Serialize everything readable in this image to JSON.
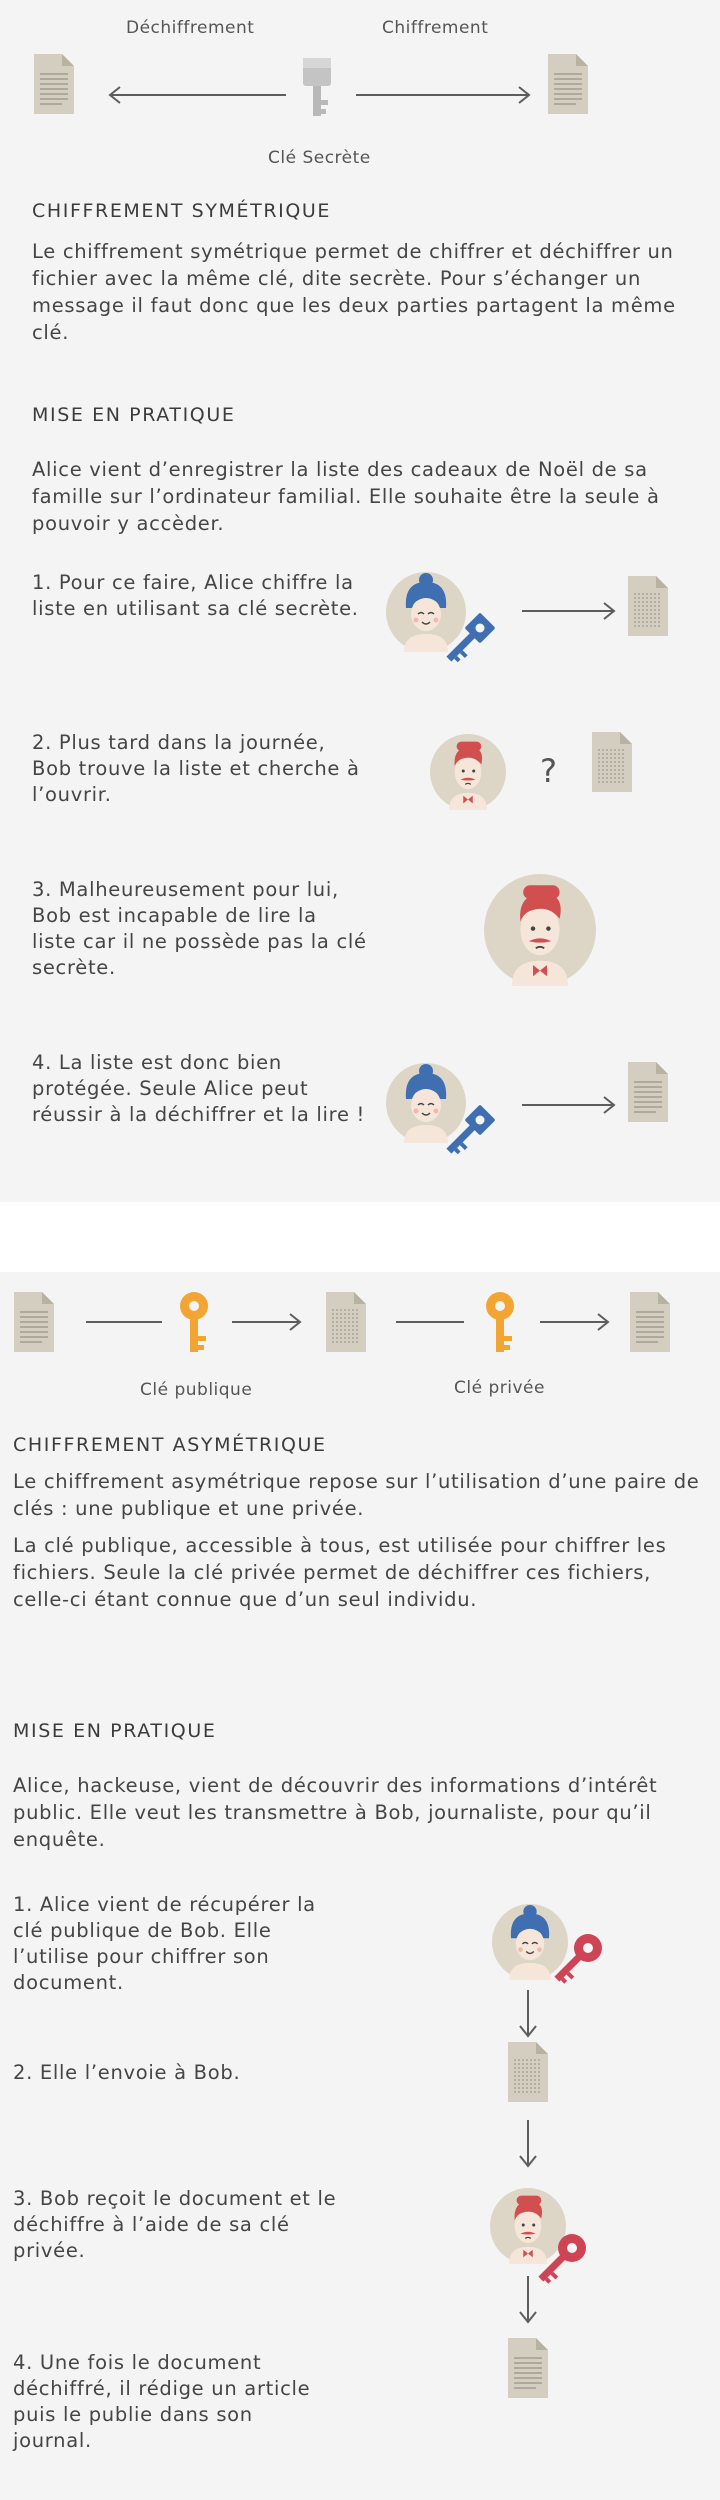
{
  "symmetric": {
    "top_labels": {
      "decrypt": "Déchiffrement",
      "encrypt": "Chiffrement",
      "key": "Clé Secrète"
    },
    "title": "CHIFFREMENT SYMÉTRIQUE",
    "description": "Le chiffrement symétrique permet de chiffrer et déchiffrer un fichier avec la même clé, dite secrète. Pour s’échanger un message il faut donc que les deux parties partagent la même clé.",
    "practice_title": "MISE EN PRATIQUE",
    "practice_intro": "Alice vient d’enregistrer la liste des cadeaux de Noël de sa famille sur l’ordinateur familial. Elle souhaite être la seule à pouvoir y accèder.",
    "steps": [
      "1. Pour ce faire, Alice chiffre la liste en utilisant sa clé secrète.",
      "2. Plus tard dans la journée, Bob trouve la liste et cherche à l’ouvrir.",
      "3. Malheureusement pour lui, Bob est incapable de lire la liste car il ne possède pas la clé secrète.",
      "4. La liste est donc bien protégée. Seule Alice peut réussir à la déchiffrer et la lire !"
    ],
    "question_mark": "?"
  },
  "asymmetric": {
    "labels": {
      "public_key": "Clé publique",
      "private_key": "Clé privée"
    },
    "title": "CHIFFREMENT ASYMÉTRIQUE",
    "description_1": "Le chiffrement asymétrique repose sur l’utilisation d’une paire de clés : une publique et une privée.",
    "description_2": "La clé publique, accessible à tous, est utilisée pour chiffrer les fichiers. Seule la clé privée permet de déchiffrer ces fichiers, celle-ci étant connue que d’un seul individu.",
    "practice_title": "MISE EN PRATIQUE",
    "practice_intro": "Alice, hackeuse, vient de découvrir des informations d’intérêt public. Elle veut les transmettre à Bob, journaliste, pour qu’il enquête.",
    "steps": [
      "1. Alice vient de récupérer la clé publique de Bob. Elle l’utilise pour chiffrer son document.",
      "2. Elle l’envoie à Bob.",
      "3. Bob reçoit le document et le déchiffre à l’aide de sa clé privée.",
      "4. Une fois le document déchiffré, il rédige un article puis le publie dans son journal."
    ]
  },
  "colors": {
    "panel": "#f4f4f4",
    "document": "#d3cebf",
    "document_lines": "#a29d8f",
    "secret_key": "#c8c8c8",
    "alice_key": "#3f6fb0",
    "public_key": "#f2a533",
    "private_key": "#cf4455",
    "avatar_bg": "#ddd6c6",
    "arrow": "#5d5d5d"
  },
  "icons": [
    "document-icon",
    "arrow-icon",
    "key-icon",
    "alice-avatar-icon",
    "bob-avatar-icon"
  ]
}
